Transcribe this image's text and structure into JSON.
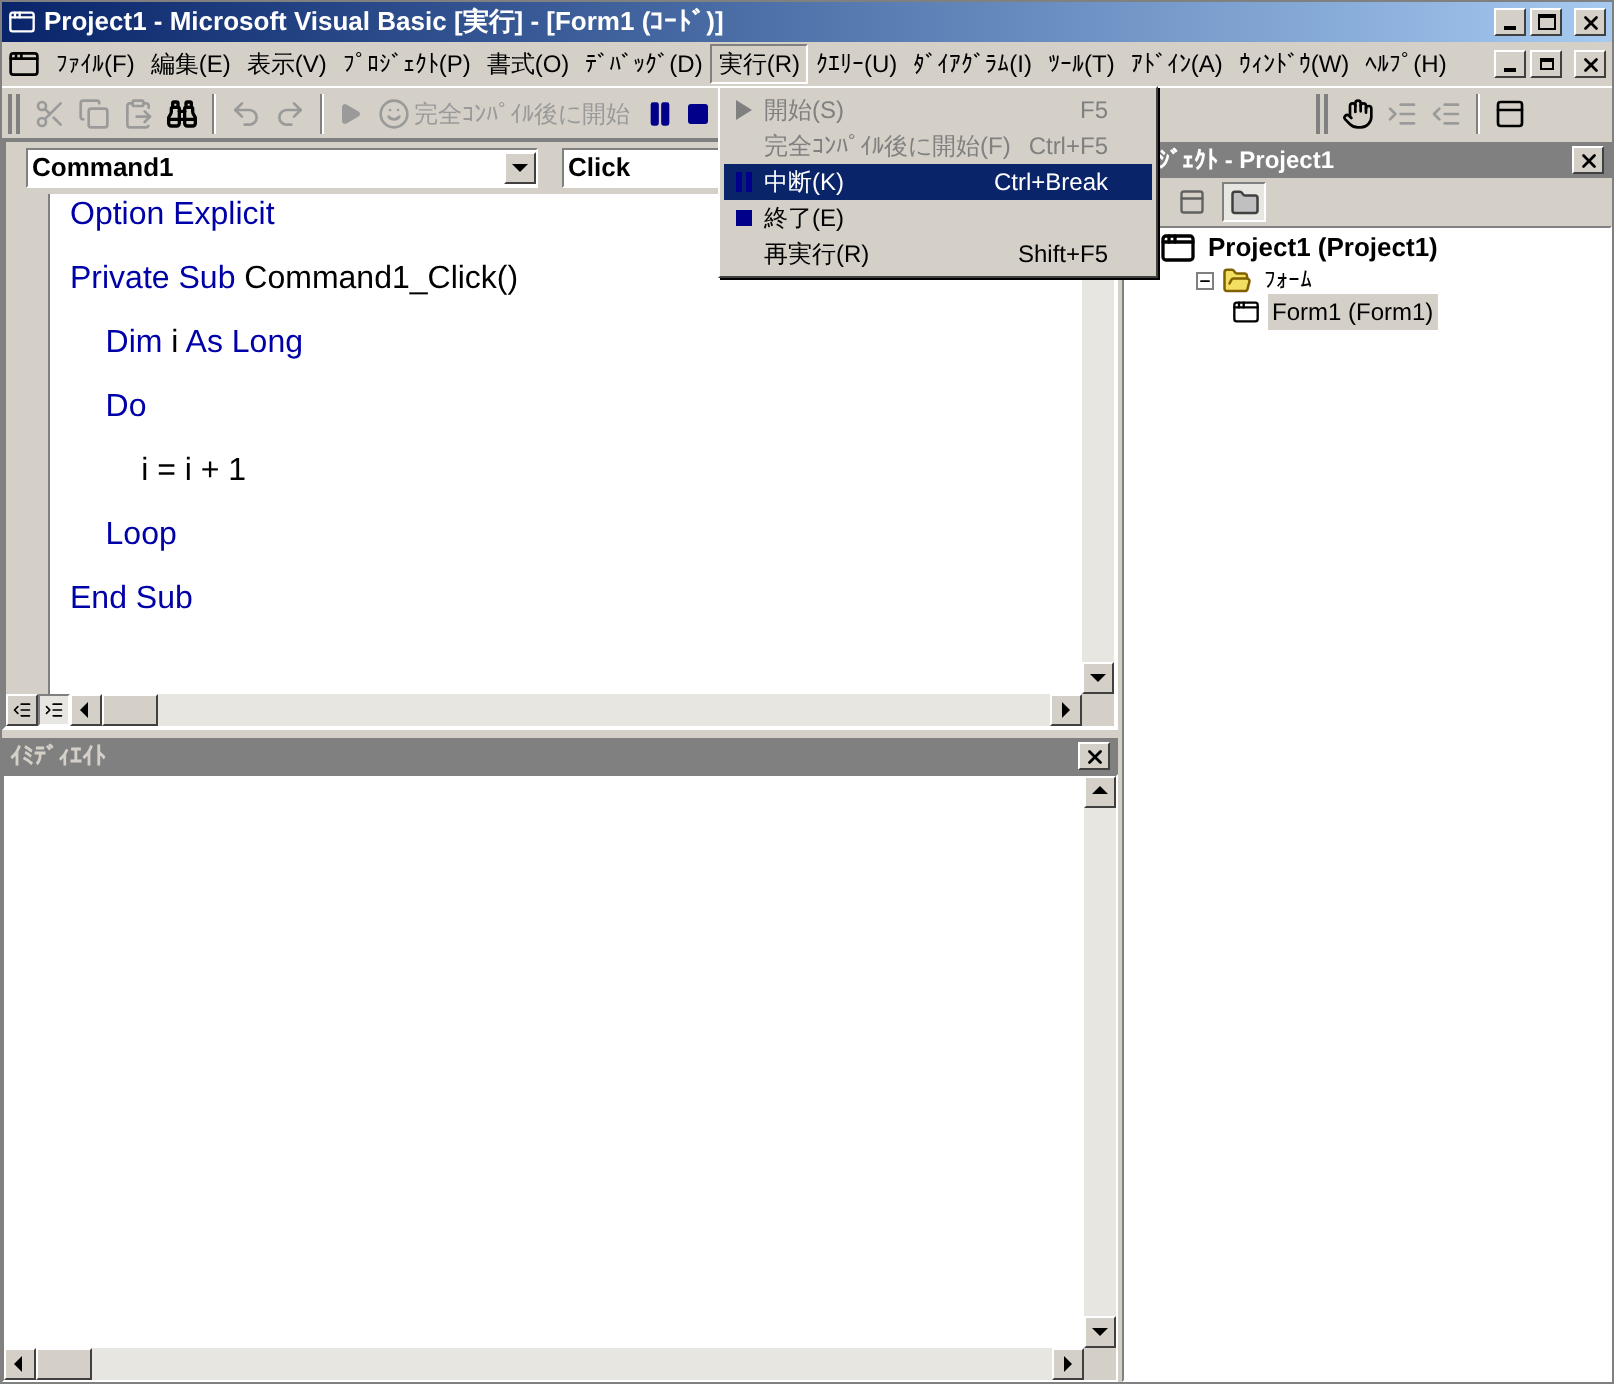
{
  "window": {
    "title": "Project1 - Microsoft Visual Basic [実行] - [Form1 (ｺｰﾄﾞ)]"
  },
  "menu_bar": [
    {
      "label": "ﾌｧｲﾙ(F)",
      "selected": false
    },
    {
      "label": "編集(E)",
      "selected": false
    },
    {
      "label": "表示(V)",
      "selected": false
    },
    {
      "label": "ﾌﾟﾛｼﾞｪｸﾄ(P)",
      "selected": false
    },
    {
      "label": "書式(O)",
      "selected": false
    },
    {
      "label": "ﾃﾞﾊﾞｯｸﾞ(D)",
      "selected": false
    },
    {
      "label": "実行(R)",
      "selected": true
    },
    {
      "label": "ｸｴﾘｰ(U)",
      "selected": false
    },
    {
      "label": "ﾀﾞｲｱｸﾞﾗﾑ(I)",
      "selected": false
    },
    {
      "label": "ﾂｰﾙ(T)",
      "selected": false
    },
    {
      "label": "ｱﾄﾞｲﾝ(A)",
      "selected": false
    },
    {
      "label": "ｳｨﾝﾄﾞｳ(W)",
      "selected": false
    },
    {
      "label": "ﾍﾙﾌﾟ(H)",
      "selected": false
    }
  ],
  "toolbar": [
    {
      "kind": "cut",
      "disabled": true
    },
    {
      "kind": "copy",
      "disabled": true
    },
    {
      "kind": "paste",
      "disabled": true
    },
    {
      "kind": "find",
      "disabled": false
    },
    {
      "kind": "separator"
    },
    {
      "kind": "undo",
      "disabled": true
    },
    {
      "kind": "redo",
      "disabled": true
    },
    {
      "kind": "separator"
    },
    {
      "kind": "start",
      "disabled": true
    },
    {
      "kind": "full_compile",
      "disabled": true,
      "label": "完全ｺﾝﾊﾟｲﾙ後に開始"
    },
    {
      "kind": "pause",
      "disabled": false
    },
    {
      "kind": "stop",
      "disabled": false
    }
  ],
  "toolbar_right": [
    {
      "kind": "toggle_breakpoint",
      "disabled": false
    },
    {
      "kind": "indent",
      "disabled": true
    },
    {
      "kind": "outdent",
      "disabled": true
    },
    {
      "kind": "separator"
    },
    {
      "kind": "object_browser",
      "disabled": false
    }
  ],
  "run_menu": [
    {
      "label": "開始(S)",
      "shortcut": "F5",
      "disabled": true,
      "selected": false,
      "kind": "start"
    },
    {
      "label": "完全ｺﾝﾊﾟｲﾙ後に開始(F)",
      "shortcut": "Ctrl+F5",
      "disabled": true,
      "selected": false,
      "kind": "full_compile"
    },
    {
      "label": "中断(K)",
      "shortcut": "Ctrl+Break",
      "disabled": false,
      "selected": true,
      "kind": "break"
    },
    {
      "label": "終了(E)",
      "disabled": false,
      "selected": false,
      "kind": "end"
    },
    {
      "label": "再実行(R)",
      "shortcut": "Shift+F5",
      "disabled": false,
      "selected": false,
      "kind": "restart"
    }
  ],
  "code_window": {
    "object": "Command1",
    "procedure": "Click",
    "lines": [
      [
        {
          "text": "Option Explicit",
          "kind": "keyword"
        }
      ],
      [
        {
          "text": "Private Sub",
          "kind": "keyword"
        },
        {
          "text": " Command1_Click()",
          "kind": "plain"
        }
      ],
      [
        {
          "text": "    Dim",
          "kind": "keyword"
        },
        {
          "text": " i ",
          "kind": "plain"
        },
        {
          "text": "As Long",
          "kind": "keyword"
        }
      ],
      [
        {
          "text": "    Do",
          "kind": "keyword"
        }
      ],
      [
        {
          "text": "        i = i + 1",
          "kind": "plain"
        }
      ],
      [
        {
          "text": "    Loop",
          "kind": "keyword"
        }
      ],
      [
        {
          "text": "End Sub",
          "kind": "keyword"
        }
      ]
    ]
  },
  "immediate_window": {
    "title": "ｲﾐﾃﾞｨｴｲﾄ"
  },
  "project_explorer": {
    "title": "ｼﾞｪｸﾄ - Project1",
    "tree": [
      {
        "label": "Project1 (Project1)",
        "kind": "project",
        "selected": false,
        "children": [
          {
            "label": "ﾌｫｰﾑ",
            "kind": "folder",
            "expanded": true,
            "selected": false,
            "children": [
              {
                "label": "Form1 (Form1)",
                "kind": "form",
                "selected": true
              }
            ]
          }
        ]
      }
    ]
  }
}
